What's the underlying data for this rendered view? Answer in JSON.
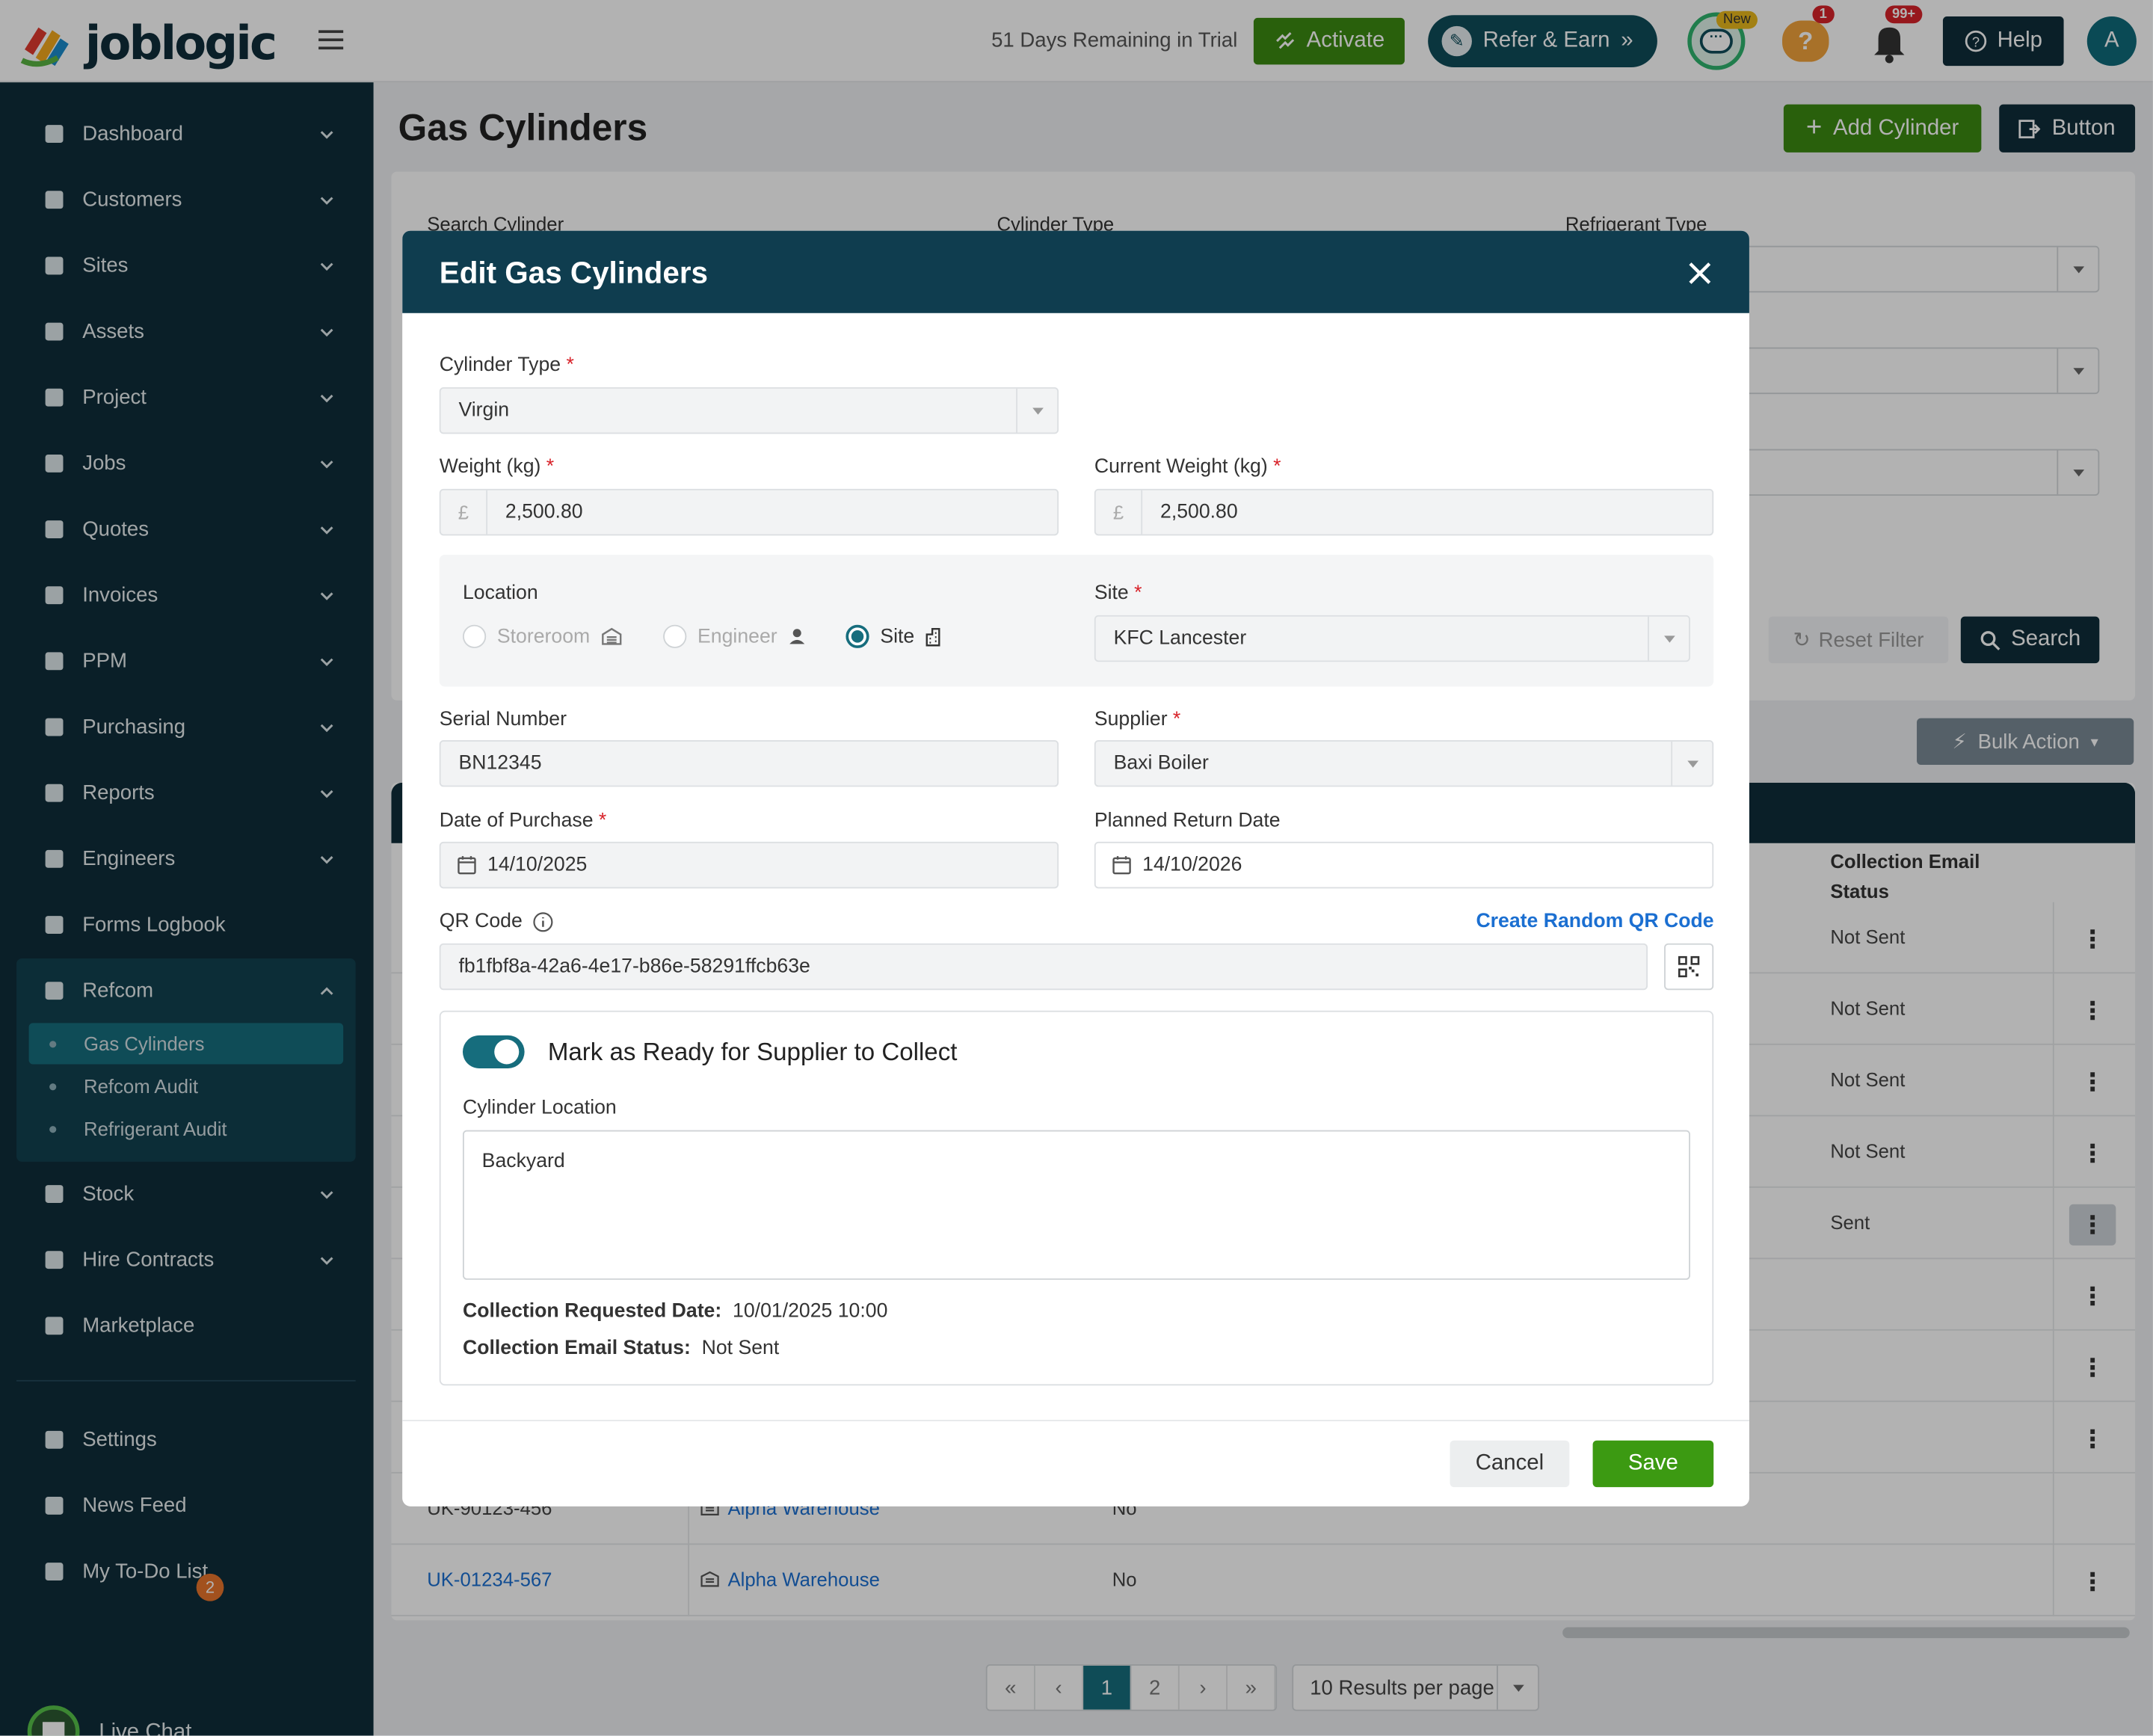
{
  "header": {
    "logo": "joblogic",
    "trial_text": "51 Days Remaining in Trial",
    "activate_label": "Activate",
    "refer_label": "Refer & Earn",
    "chat_new_badge": "New",
    "alerts_count": "1",
    "notifications_count": "99+",
    "help_label": "Help",
    "avatar_initial": "A"
  },
  "sidebar": {
    "items": [
      {
        "label": "Dashboard",
        "icon": "dashboard-icon"
      },
      {
        "label": "Customers",
        "icon": "user-icon"
      },
      {
        "label": "Sites",
        "icon": "building-icon"
      },
      {
        "label": "Assets",
        "icon": "asset-icon"
      },
      {
        "label": "Project",
        "icon": "project-icon"
      },
      {
        "label": "Jobs",
        "icon": "wrench-icon"
      },
      {
        "label": "Quotes",
        "icon": "clipboard-icon"
      },
      {
        "label": "Invoices",
        "icon": "card-icon"
      },
      {
        "label": "PPM",
        "icon": "calendar-check-icon"
      },
      {
        "label": "Purchasing",
        "icon": "document-icon"
      },
      {
        "label": "Reports",
        "icon": "pie-chart-icon"
      },
      {
        "label": "Engineers",
        "icon": "users-icon"
      },
      {
        "label": "Forms Logbook",
        "icon": "book-icon"
      },
      {
        "label": "Refcom",
        "icon": "cylinder-icon"
      }
    ],
    "refcom_sub": [
      {
        "label": "Gas Cylinders"
      },
      {
        "label": "Refcom Audit"
      },
      {
        "label": "Refrigerant Audit"
      }
    ],
    "lower_items": [
      {
        "label": "Stock",
        "icon": "warehouse-icon"
      },
      {
        "label": "Hire Contracts",
        "icon": "contract-icon"
      },
      {
        "label": "Marketplace",
        "icon": "grid-icon"
      }
    ],
    "bottom_items": [
      {
        "label": "Settings",
        "icon": "user-gear-icon"
      },
      {
        "label": "News Feed",
        "icon": "news-icon",
        "badge": "2"
      },
      {
        "label": "My To-Do List",
        "icon": "todo-icon"
      }
    ],
    "live_chat": "Live Chat"
  },
  "page": {
    "title": "Gas Cylinders",
    "add_button": "Add Cylinder",
    "extra_button": "Button"
  },
  "filters": {
    "search_label": "Search Cylinder",
    "type_label": "Cylinder Type",
    "refrigerant_label": "Refrigerant Type",
    "reset_label": "Reset Filter",
    "search_button": "Search",
    "bulk_label": "Bulk Action"
  },
  "table": {
    "column_collection": "Collection Email Status",
    "column_collection_l1": "Collection Email",
    "column_collection_l2": "Status",
    "rows": [
      {
        "status": "Not Sent"
      },
      {
        "status": "Not Sent"
      },
      {
        "status": "Not Sent"
      },
      {
        "status": "Not Sent"
      },
      {
        "status": "Sent"
      },
      {
        "status": ""
      },
      {
        "status": ""
      },
      {
        "status": ""
      },
      {
        "serial": "UK-90123-456",
        "site": "Alpha Warehouse",
        "ready": "No",
        "status": ""
      },
      {
        "serial": "UK-01234-567",
        "site": "Alpha Warehouse",
        "ready": "No",
        "status": ""
      }
    ]
  },
  "pagination": {
    "first": "«",
    "prev": "‹",
    "pages": [
      "1",
      "2"
    ],
    "next": "›",
    "last": "»",
    "per_page": "10 Results per page"
  },
  "modal": {
    "title": "Edit Gas Cylinders",
    "cylinder_type_label": "Cylinder Type",
    "cylinder_type_value": "Virgin",
    "weight_label": "Weight (kg)",
    "weight_prefix": "£",
    "weight_value": "2,500.80",
    "current_weight_label": "Current Weight (kg)",
    "current_weight_value": "2,500.80",
    "location_label": "Location",
    "location_options": [
      "Storeroom",
      "Engineer",
      "Site"
    ],
    "location_selected": "Site",
    "site_label": "Site",
    "site_value": "KFC Lancester",
    "serial_label": "Serial Number",
    "serial_value": "BN12345",
    "supplier_label": "Supplier",
    "supplier_value": "Baxi Boiler",
    "purchase_date_label": "Date of Purchase",
    "purchase_date_value": "14/10/2025",
    "return_date_label": "Planned Return Date",
    "return_date_value": "14/10/2026",
    "qr_label": "QR Code",
    "qr_link": "Create Random QR Code",
    "qr_value": "fb1fbf8a-42a6-4e17-b86e-58291ffcb63e",
    "ready_toggle_label": "Mark as Ready for Supplier to Collect",
    "ready_toggle_on": true,
    "cylinder_location_label": "Cylinder Location",
    "cylinder_location_value": "Backyard",
    "collection_date_label": "Collection Requested Date:",
    "collection_date_value": "10/01/2025 10:00",
    "collection_status_label": "Collection Email Status:",
    "collection_status_value": "Not Sent",
    "cancel_label": "Cancel",
    "save_label": "Save"
  },
  "colors": {
    "sidebar_bg": "#0f2d3a",
    "modal_header": "#0f3d4f",
    "accent_teal": "#166d7d",
    "primary_green": "#3c9a12",
    "link_blue": "#1b6fd1",
    "required_red": "#d8232a"
  }
}
